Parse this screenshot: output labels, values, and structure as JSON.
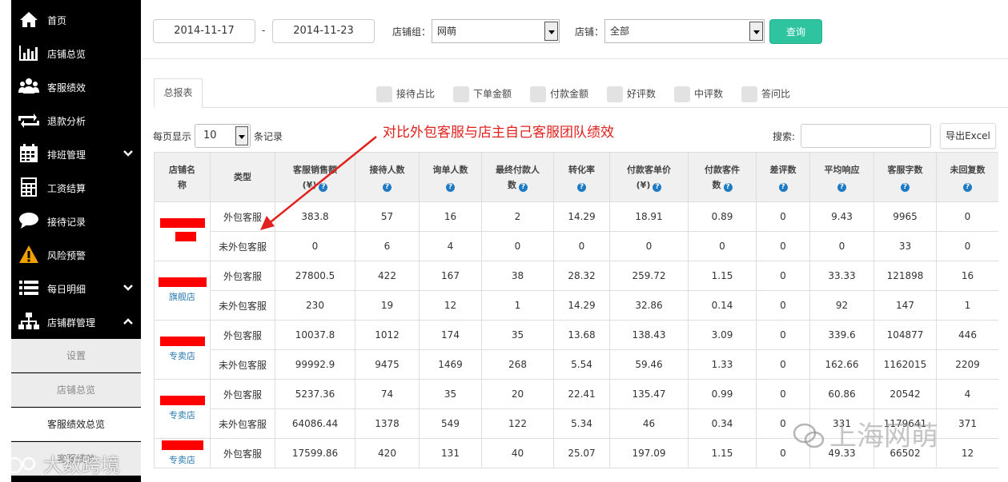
{
  "sidebar": {
    "items": [
      {
        "label": "首页",
        "icon": "home-icon"
      },
      {
        "label": "店铺总览",
        "icon": "bar-chart-icon"
      },
      {
        "label": "客服绩效",
        "icon": "users-icon"
      },
      {
        "label": "退款分析",
        "icon": "retweet-icon"
      },
      {
        "label": "排班管理",
        "icon": "calendar-icon",
        "expandable": true
      },
      {
        "label": "工资结算",
        "icon": "calculator-icon"
      },
      {
        "label": "接待记录",
        "icon": "chat-bubble-icon"
      },
      {
        "label": "风险预警",
        "icon": "warning-icon"
      },
      {
        "label": "每日明细",
        "icon": "list-icon",
        "expandable": true
      },
      {
        "label": "店铺群管理",
        "icon": "sitemap-icon",
        "expandable": true,
        "expanded": true
      }
    ],
    "subitems": [
      {
        "label": "设置"
      },
      {
        "label": "店铺总览"
      },
      {
        "label": "客服绩效总览",
        "active": true
      },
      {
        "label": "客服绩效"
      }
    ]
  },
  "filters": {
    "start_date": "2014-11-17",
    "date_separator": "-",
    "end_date": "2014-11-23",
    "store_group_label": "店铺组：",
    "store_group_value": "网萌",
    "store_label": "店铺：",
    "store_value": "全部",
    "query_label": "查询"
  },
  "tabs": {
    "report_label": "总报表",
    "metrics": [
      "接待占比",
      "下单金额",
      "付款金额",
      "好评数",
      "中评数",
      "答问比"
    ]
  },
  "controls": {
    "page_size_prefix": "每页显示",
    "page_size": "10",
    "page_size_suffix": "条记录",
    "annotation": "对比外包客服与店主自己客服团队绩效",
    "search_label": "搜索:",
    "export_label": "导出Excel"
  },
  "table": {
    "headers": [
      {
        "line1": "店铺名",
        "line2": "称"
      },
      {
        "line1": "类型",
        "line2": ""
      },
      {
        "line1": "客服销售额",
        "line2": "(¥)",
        "help": true
      },
      {
        "line1": "接待人数",
        "line2": "",
        "help": true
      },
      {
        "line1": "询单人数",
        "line2": "",
        "help": true
      },
      {
        "line1": "最终付款人",
        "line2": "数",
        "help": true
      },
      {
        "line1": "转化率",
        "line2": "",
        "help": true
      },
      {
        "line1": "付款客单价",
        "line2": "(¥)",
        "help": true
      },
      {
        "line1": "付款客件",
        "line2": "数",
        "help": true
      },
      {
        "line1": "差评数",
        "line2": "",
        "help": true
      },
      {
        "line1": "平均响应",
        "line2": "",
        "help": true
      },
      {
        "line1": "客服字数",
        "line2": "",
        "help": true
      },
      {
        "line1": "未回复数",
        "line2": "",
        "help": true
      }
    ],
    "groups": [
      {
        "store_suffix": "",
        "rows": [
          {
            "type": "外包客服",
            "values": [
              "383.8",
              "57",
              "16",
              "2",
              "14.29",
              "18.91",
              "0.89",
              "0",
              "9.43",
              "9965",
              "0"
            ]
          },
          {
            "type": "未外包客服",
            "values": [
              "0",
              "6",
              "4",
              "0",
              "0",
              "0",
              "0",
              "0",
              "0",
              "33",
              "0"
            ]
          }
        ]
      },
      {
        "store_suffix": "旗舰店",
        "rows": [
          {
            "type": "外包客服",
            "values": [
              "27800.5",
              "422",
              "167",
              "38",
              "28.32",
              "259.72",
              "1.15",
              "0",
              "33.33",
              "121898",
              "16"
            ]
          },
          {
            "type": "未外包客服",
            "values": [
              "230",
              "19",
              "12",
              "1",
              "14.29",
              "32.86",
              "0.14",
              "0",
              "92",
              "147",
              "1"
            ]
          }
        ]
      },
      {
        "store_suffix": "专卖店",
        "rows": [
          {
            "type": "外包客服",
            "values": [
              "10037.8",
              "1012",
              "174",
              "35",
              "13.68",
              "138.43",
              "3.09",
              "0",
              "339.6",
              "104877",
              "446"
            ]
          },
          {
            "type": "未外包客服",
            "values": [
              "99992.9",
              "9475",
              "1469",
              "268",
              "5.54",
              "59.46",
              "1.33",
              "0",
              "162.66",
              "1162015",
              "2209"
            ]
          }
        ]
      },
      {
        "store_suffix": "专卖店",
        "rows": [
          {
            "type": "外包客服",
            "values": [
              "5237.36",
              "74",
              "35",
              "20",
              "22.41",
              "135.47",
              "0.99",
              "0",
              "60.86",
              "20542",
              "4"
            ]
          },
          {
            "type": "未外包客服",
            "values": [
              "64086.44",
              "1378",
              "549",
              "122",
              "5.34",
              "46",
              "0.34",
              "0",
              "331",
              "1179641",
              "371"
            ]
          }
        ]
      },
      {
        "store_suffix": "专卖店",
        "rows": [
          {
            "type": "外包客服",
            "values": [
              "17599.86",
              "420",
              "131",
              "40",
              "25.07",
              "197.09",
              "1.15",
              "0",
              "49.33",
              "66502",
              "12"
            ]
          }
        ]
      }
    ]
  },
  "watermarks": {
    "right": "上海网萌",
    "left": "大数跨境"
  },
  "colors": {
    "sidebar_bg": "#000000",
    "accent_green": "#2ec4a0",
    "annotation_red": "#e0211d",
    "help_icon_blue": "#1e7ac2",
    "redaction_red": "#ff0000"
  }
}
